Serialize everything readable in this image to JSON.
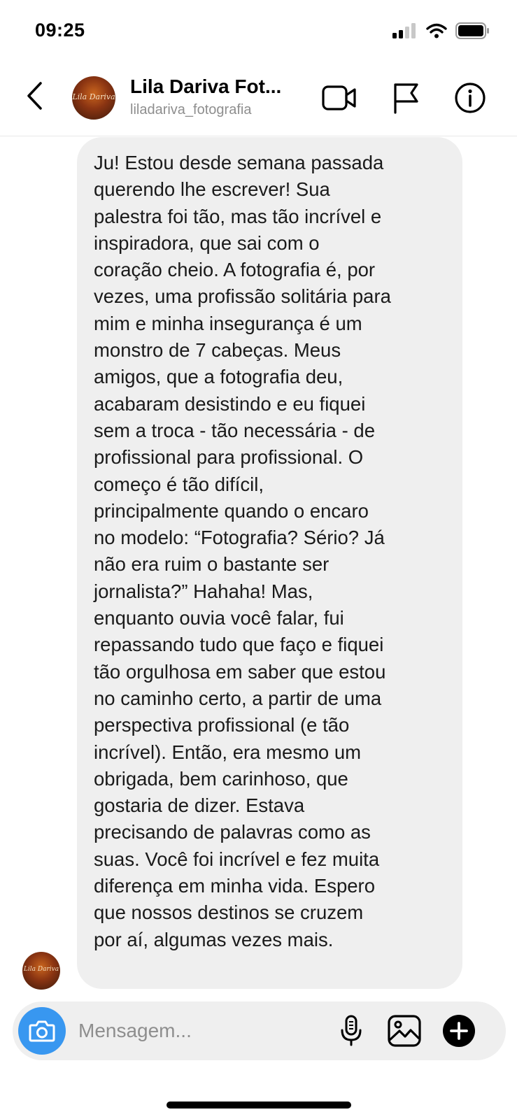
{
  "status_bar": {
    "time": "09:25"
  },
  "header": {
    "contact_name": "Lila Dariva Fot...",
    "contact_handle": "liladariva_fotografia",
    "avatar_script": "Lila Dariva"
  },
  "message": {
    "text": "Ju! Estou desde semana passada\nquerendo lhe escrever! Sua\npalestra foi tão, mas tão incrível e\ninspiradora, que sai com o\ncoração cheio. A fotografia é, por\nvezes, uma profissão solitária para\nmim e minha insegurança é um\nmonstro de 7 cabeças. Meus\namigos, que a fotografia deu,\nacabaram desistindo e eu fiquei\nsem a troca - tão necessária - de\nprofissional para profissional. O\ncomeço é tão difícil,\nprincipalmente quando o encaro\nno modelo: “Fotografia? Sério? Já\nnão era ruim o bastante ser\njornalista?” Hahaha! Mas,\nenquanto ouvia você falar, fui\nrepassando tudo que faço e fiquei\ntão orgulhosa em saber que estou\nno caminho certo, a partir de uma\nperspectiva profissional (e tão\nincrível). Então, era mesmo um\nobrigada, bem carinhoso, que\ngostaria de dizer. Estava\nprecisando de palavras como as\nsuas. Você foi incrível e fez muita\ndiferença em minha vida. Espero\nque nossos destinos se cruzem\npor aí, algumas vezes mais."
  },
  "composer": {
    "placeholder": "Mensagem..."
  },
  "colors": {
    "accent": "#3897f0",
    "bubble": "#efefef",
    "muted": "#8e8e8e"
  },
  "icons": [
    "back-icon",
    "video-call-icon",
    "flag-icon",
    "info-icon",
    "camera-icon",
    "microphone-icon",
    "gallery-icon",
    "plus-icon",
    "signal-icon",
    "wifi-icon",
    "battery-icon"
  ]
}
